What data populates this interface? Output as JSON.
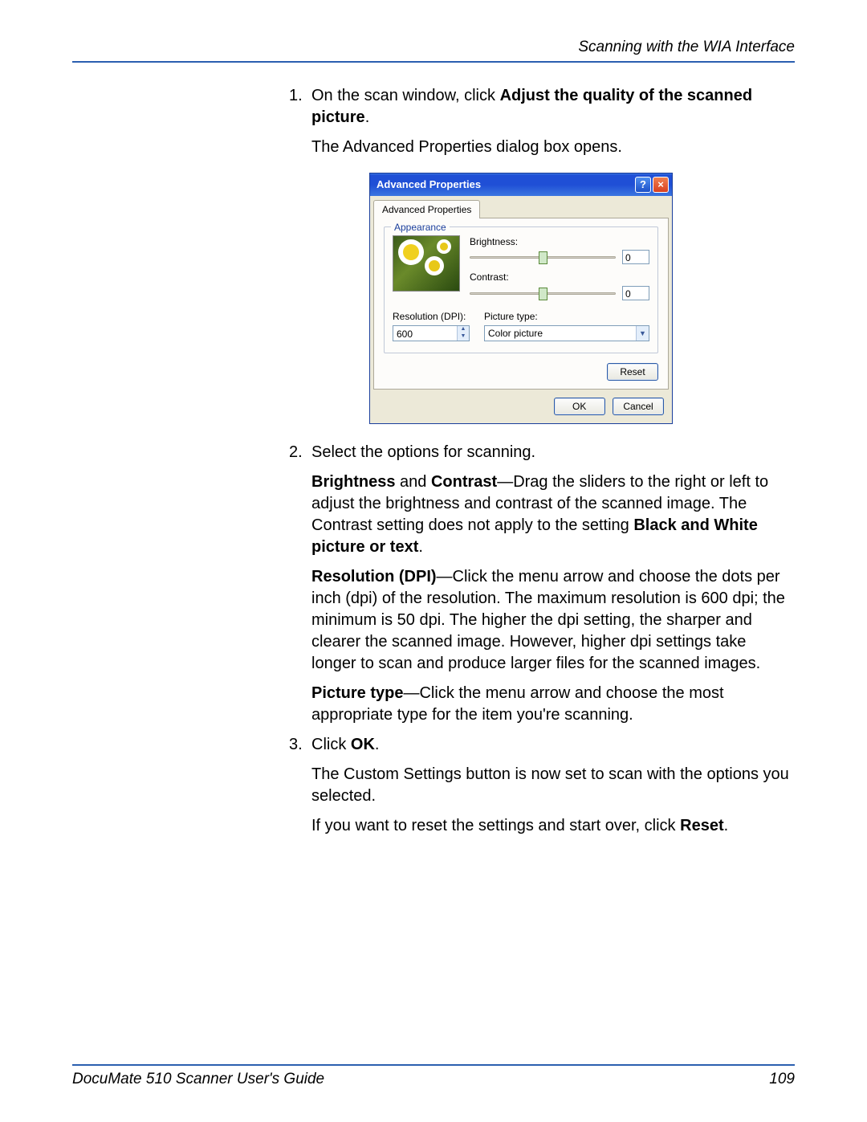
{
  "header": {
    "section_title": "Scanning with the WIA Interface"
  },
  "steps": {
    "s1_num": "1.",
    "s1_a": "On the scan window, click ",
    "s1_b": "Adjust the quality of the scanned picture",
    "s1_c": ".",
    "s1_after": "The Advanced Properties dialog box opens.",
    "s2_num": "2.",
    "s2_text": "Select the options for scanning.",
    "bc_a": "Brightness",
    "bc_b": " and ",
    "bc_c": "Contrast",
    "bc_d": "—Drag the sliders to the right or left to adjust the brightness and contrast of the scanned image. The Contrast setting does not apply to the setting ",
    "bc_e": "Black and White picture or text",
    "bc_f": ".",
    "res_a": "Resolution (DPI)",
    "res_b": "—Click the menu arrow and choose the dots per inch (dpi) of the resolution. The maximum resolution is 600 dpi; the minimum is 50 dpi. The higher the dpi setting, the sharper and clearer the scanned image. However, higher dpi settings take longer to scan and produce larger files for the scanned images.",
    "pt_a": "Picture type",
    "pt_b": "—Click the menu arrow and choose the most appropriate type for the item you're scanning.",
    "s3_num": "3.",
    "s3_a": "Click ",
    "s3_b": "OK",
    "s3_c": ".",
    "s3_after": "The Custom Settings button is now set to scan with the options you selected.",
    "reset_a": "If you want to reset the settings and start over, click ",
    "reset_b": "Reset",
    "reset_c": "."
  },
  "dialog": {
    "title": "Advanced Properties",
    "tab": "Advanced Properties",
    "group": "Appearance",
    "brightness_label": "Brightness:",
    "brightness_value": "0",
    "contrast_label": "Contrast:",
    "contrast_value": "0",
    "resolution_label": "Resolution (DPI):",
    "resolution_value": "600",
    "picture_type_label": "Picture type:",
    "picture_type_value": "Color picture",
    "reset": "Reset",
    "ok": "OK",
    "cancel": "Cancel"
  },
  "footer": {
    "guide": "DocuMate 510 Scanner User's Guide",
    "page": "109"
  }
}
